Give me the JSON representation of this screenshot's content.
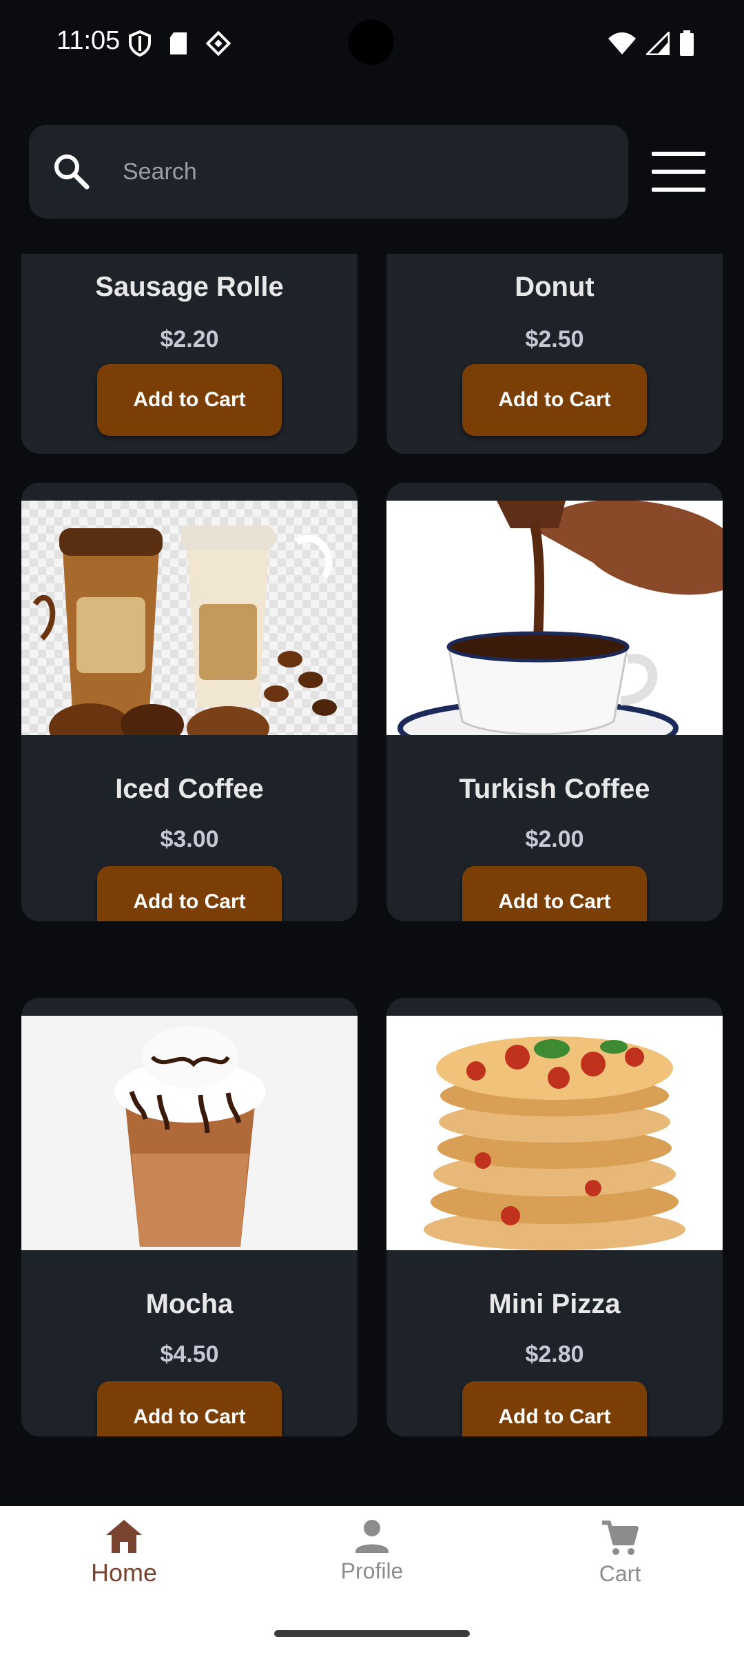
{
  "status_bar": {
    "time": "11:05",
    "left_icons": [
      "shield-icon",
      "sd-card-icon",
      "diamond-app-icon"
    ],
    "right_icons": [
      "wifi-icon",
      "signal-icon",
      "battery-icon"
    ]
  },
  "header": {
    "search": {
      "placeholder": "Search",
      "value": ""
    },
    "menu_icon": "hamburger-menu-icon"
  },
  "products": [
    {
      "name": "Sausage Rolle",
      "price": "$2.20",
      "button": "Add to Cart"
    },
    {
      "name": "Donut",
      "price": "$2.50",
      "button": "Add to Cart"
    },
    {
      "name": "Iced Coffee",
      "price": "$3.00",
      "button": "Add to Cart",
      "image": "iced-coffee-cups-image"
    },
    {
      "name": "Turkish Coffee",
      "price": "$2.00",
      "button": "Add to Cart",
      "image": "turkish-coffee-pour-image"
    },
    {
      "name": "Mocha",
      "price": "$4.50",
      "button": "Add to Cart",
      "image": "mocha-drink-image"
    },
    {
      "name": "Mini Pizza",
      "price": "$2.80",
      "button": "Add to Cart",
      "image": "mini-pizza-stack-image"
    }
  ],
  "bottom_nav": {
    "items": [
      {
        "label": "Home",
        "icon": "home-icon",
        "active": true
      },
      {
        "label": "Profile",
        "icon": "person-icon",
        "active": false
      },
      {
        "label": "Cart",
        "icon": "cart-icon",
        "active": false
      }
    ]
  },
  "colors": {
    "background": "#0b0c10",
    "card": "#1e2229",
    "button": "#7b3f06",
    "nav_active": "#7a4530",
    "nav_inactive": "#8c8c8c"
  }
}
